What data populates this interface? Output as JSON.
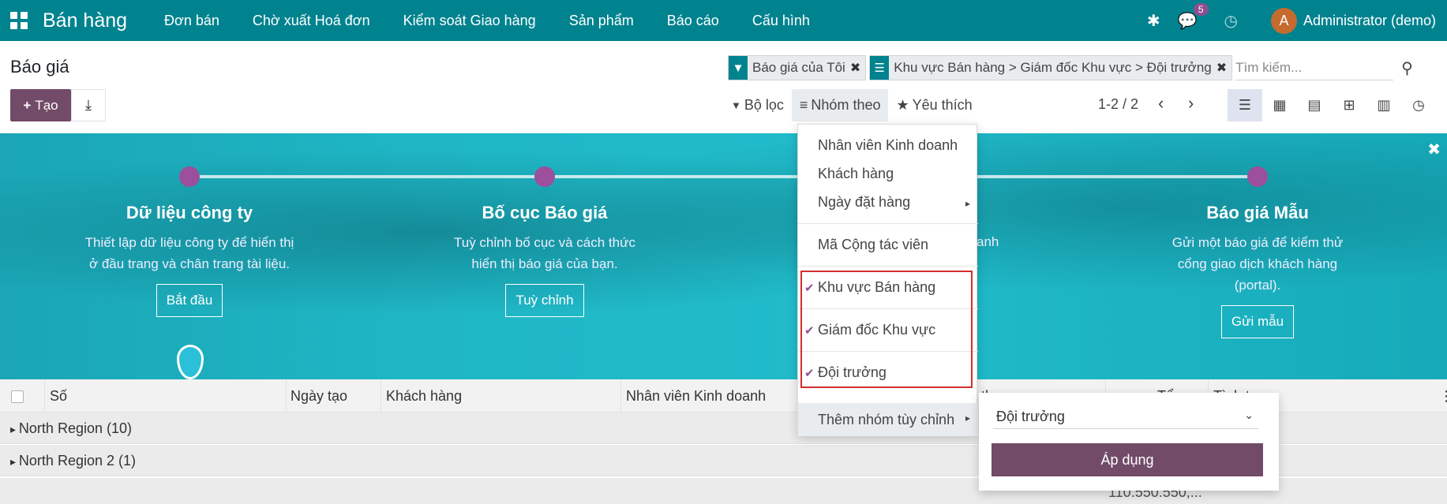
{
  "navbar": {
    "brand": "Bán hàng",
    "menu": [
      "Đơn bán",
      "Chờ xuất Hoá đơn",
      "Kiểm soát Giao hàng",
      "Sản phẩm",
      "Báo cáo",
      "Cấu hình"
    ],
    "message_count": "5",
    "avatar_letter": "A",
    "user": "Administrator (demo)"
  },
  "page": {
    "title": "Báo giá",
    "create_label": "Tạo"
  },
  "search": {
    "facets": [
      "Báo giá của Tôi",
      "Khu vực Bán hàng > Giám đốc Khu vực > Đội trưởng"
    ],
    "placeholder": "Tìm kiếm..."
  },
  "filters": {
    "filter_label": "Bộ lọc",
    "groupby_label": "Nhóm theo",
    "favorites_label": "Yêu thích"
  },
  "pager": {
    "text": "1-2 / 2"
  },
  "banner": {
    "steps": [
      {
        "title": "Dữ liệu công ty",
        "desc": "Thiết lập dữ liệu công ty để hiển thị ở đầu trang và chân trang tài liệu.",
        "button": "Bắt đầu"
      },
      {
        "title": "Bố cục Báo giá",
        "desc": "Tuỳ chỉnh bố cục và cách thức hiển thị báo giá của bạn.",
        "button": "Tuỳ chỉnh"
      },
      {
        "title": "",
        "desc": "anh",
        "button": ""
      },
      {
        "title": "Báo giá Mẫu",
        "desc": "Gửi một báo giá để kiểm thử cổng giao dịch khách hàng (portal).",
        "button": "Gửi mẫu"
      }
    ]
  },
  "table": {
    "columns": [
      "Số",
      "Ngày tạo",
      "Khách hàng",
      "Nhân viên Kinh doanh",
      "theo",
      "Tổng",
      "Tình trạng"
    ],
    "groups": [
      "North Region (10)",
      "North Region 2 (1)"
    ],
    "row3_amount": "110.550.550,..."
  },
  "groupby_menu": {
    "items": [
      "Nhân viên Kinh doanh",
      "Khách hàng",
      "Ngày đặt hàng",
      "Mã Cộng tác viên",
      "Khu vực Bán hàng",
      "Giám đốc Khu vực",
      "Đội trưởng"
    ],
    "custom_label": "Thêm nhóm tùy chỉnh"
  },
  "custom_group": {
    "selected": "Đội trưởng",
    "apply_label": "Áp dụng"
  },
  "colors": {
    "navbar": "#00838f",
    "primary": "#714b67",
    "highlight": "#d32f2f"
  }
}
